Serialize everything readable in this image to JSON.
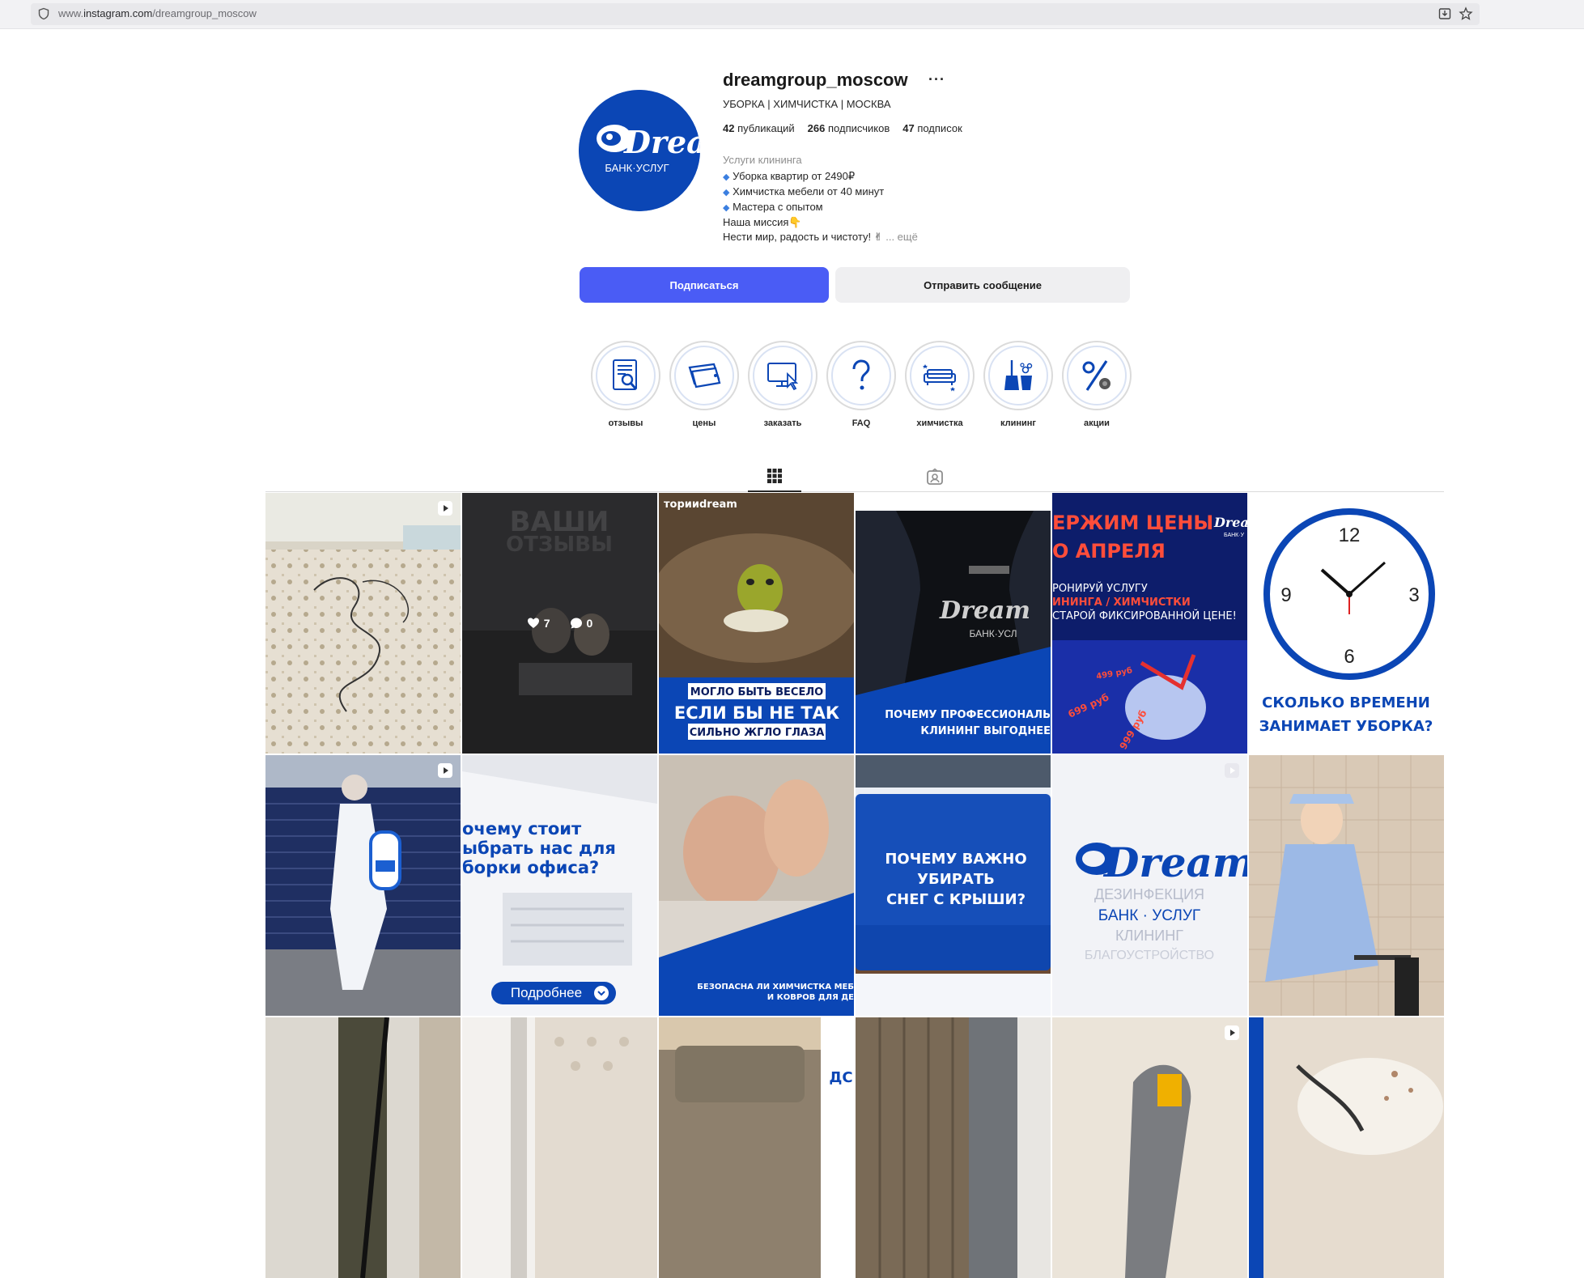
{
  "browser": {
    "url_prefix": "www.",
    "url_host": "instagram.com",
    "url_path": "/dreamgroup_moscow"
  },
  "profile": {
    "username": "dreamgroup_moscow",
    "more": "···",
    "category": "УБОРКА | ХИМЧИСТКА | МОСКВА",
    "avatar_brand": "Dream",
    "avatar_sub": "БАНК·УСЛУГ",
    "stats": {
      "posts_count": "42",
      "posts_label": "публикаций",
      "followers_count": "266",
      "followers_label": "подписчиков",
      "following_count": "47",
      "following_label": "подписок"
    },
    "bio": {
      "category": "Услуги клининга",
      "line1": "Уборка квартир от 2490₽",
      "line2": "Химчистка мебели от 40 минут",
      "line3": "Мастера с опытом",
      "line4": "Наша миссия👇",
      "line5": "Нести мир, радость и чистоту! ✌",
      "more": "... ещё"
    }
  },
  "actions": {
    "follow": "Подписаться",
    "message": "Отправить сообщение"
  },
  "highlights": [
    {
      "label": "отзывы",
      "icon": "review-icon"
    },
    {
      "label": "цены",
      "icon": "price-tag-icon"
    },
    {
      "label": "заказать",
      "icon": "order-screen-icon"
    },
    {
      "label": "FAQ",
      "icon": "question-icon"
    },
    {
      "label": "химчистка",
      "icon": "sofa-icon"
    },
    {
      "label": "клининг",
      "icon": "broom-bucket-icon"
    },
    {
      "label": "акции",
      "icon": "percent-icon"
    }
  ],
  "tabs": {
    "posts_icon": "grid-icon",
    "tagged_icon": "tagged-icon"
  },
  "posts": {
    "p2": {
      "title1": "ВАШИ",
      "title2": "ОТЗЫВЫ",
      "likes": "7",
      "comments": "0"
    },
    "p3": {
      "tag": "торииdream",
      "l1": "МОГЛО БЫТЬ ВЕСЕЛО",
      "l2": "ЕСЛИ БЫ НЕ ТАК",
      "l3": "СИЛЬНО ЖГЛО ГЛАЗА"
    },
    "p4": {
      "l1": "ПОЧЕМУ ПРОФЕССИОНАЛЬ",
      "l2": "КЛИНИНГ ВЫГОДНЕЕ",
      "brand": "Dream",
      "sub": "БАНК·УСЛ"
    },
    "p5": {
      "l1": "ЕРЖИМ ЦЕНЫ",
      "l2": "О АПРЕЛЯ",
      "l3": "РОНИРУЙ УСЛУГУ",
      "l4": "ИНИНГА / ХИМЧИСТКИ",
      "l5": "СТАРОЙ ФИКСИРОВАННОЙ ЦЕНЕ!",
      "price1": "499 руб",
      "price2": "699 руб",
      "price3": "999 руб",
      "brand": "Drea",
      "sub": "БАНК·У"
    },
    "p6": {
      "l1": "СКОЛЬКО ВРЕМЕНИ",
      "l2": "ЗАНИМАЕТ УБОРКА?",
      "n12": "12",
      "n3": "3",
      "n6": "6",
      "n9": "9"
    },
    "p8": {
      "l1": "очему стоит",
      "l2": "ыбрать нас для",
      "l3": "борки офиса?",
      "btn": "Подробнее"
    },
    "p9": {
      "l1": "БЕЗОПАСНА ЛИ ХИМЧИСТКА МЕБ",
      "l2": "И КОВРОВ ДЛЯ ДЕ"
    },
    "p10": {
      "l1": "ПОЧЕМУ ВАЖНО",
      "l2": "УБИРАТЬ",
      "l3": "СНЕГ С КРЫШИ?"
    },
    "p11": {
      "brand": "Dream",
      "w1": "ДЕЗИНФЕКЦИЯ",
      "w2": "БАНК · УСЛУГ",
      "w3": "КЛИНИНГ",
      "w4": "БЛАГОУСТРОЙСТВО"
    },
    "p15": {
      "l1": "ДС"
    }
  },
  "colors": {
    "brand_blue": "#0b46b5",
    "follow_button": "#4a5cf5",
    "navy": "#0a1c5e"
  }
}
